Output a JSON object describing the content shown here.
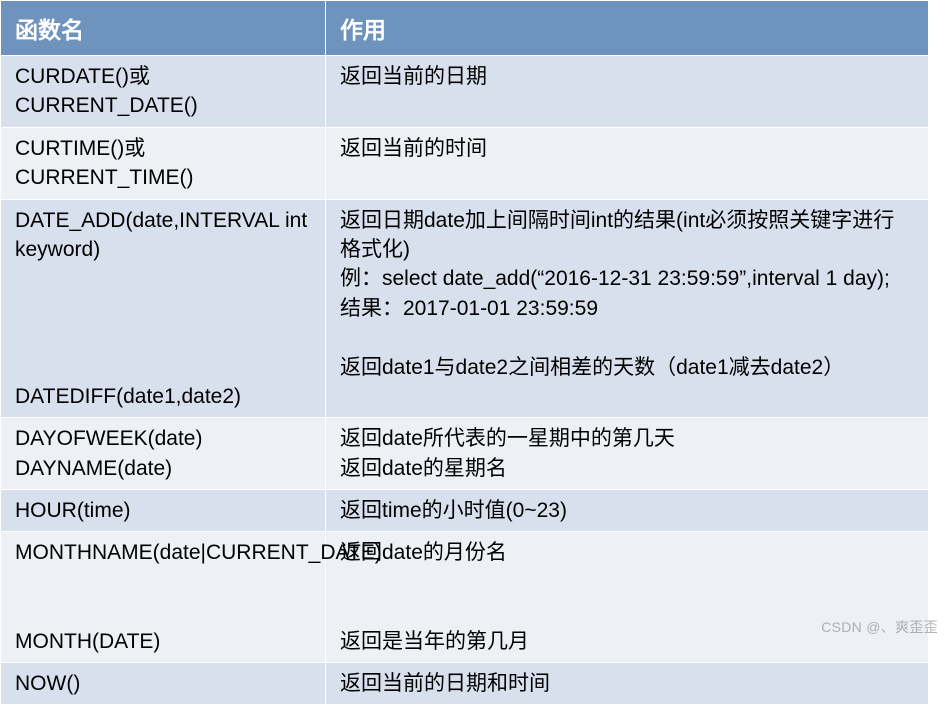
{
  "headers": {
    "col1": "函数名",
    "col2": "作用"
  },
  "rows": [
    {
      "name": "CURDATE()或\nCURRENT_DATE()",
      "desc": "返回当前的日期"
    },
    {
      "name": "CURTIME()或\nCURRENT_TIME()",
      "desc": "返回当前的时间"
    },
    {
      "name": "DATE_ADD(date,INTERVAL int keyword)\n\n\n\n\nDATEDIFF(date1,date2)",
      "desc": "返回日期date加上间隔时间int的结果(int必须按照关键字进行格式化)\n例：select date_add(“2016-12-31 23:59:59”,interval 1 day);\n结果：2017-01-01 23:59:59\n\n返回date1与date2之间相差的天数（date1减去date2）"
    },
    {
      "name": "DAYOFWEEK(date)\nDAYNAME(date)",
      "desc": "返回date所代表的一星期中的第几天\n返回date的星期名"
    },
    {
      "name": "HOUR(time)",
      "desc": "返回time的小时值(0~23)"
    },
    {
      "name": "MONTHNAME(date|CURRENT_DATE)\n\n\nMONTH(DATE)",
      "desc": "返回date的月份名\n\n\n返回是当年的第几月"
    },
    {
      "name": "NOW()",
      "desc": "返回当前的日期和时间"
    }
  ],
  "watermark": "CSDN @、爽歪歪"
}
